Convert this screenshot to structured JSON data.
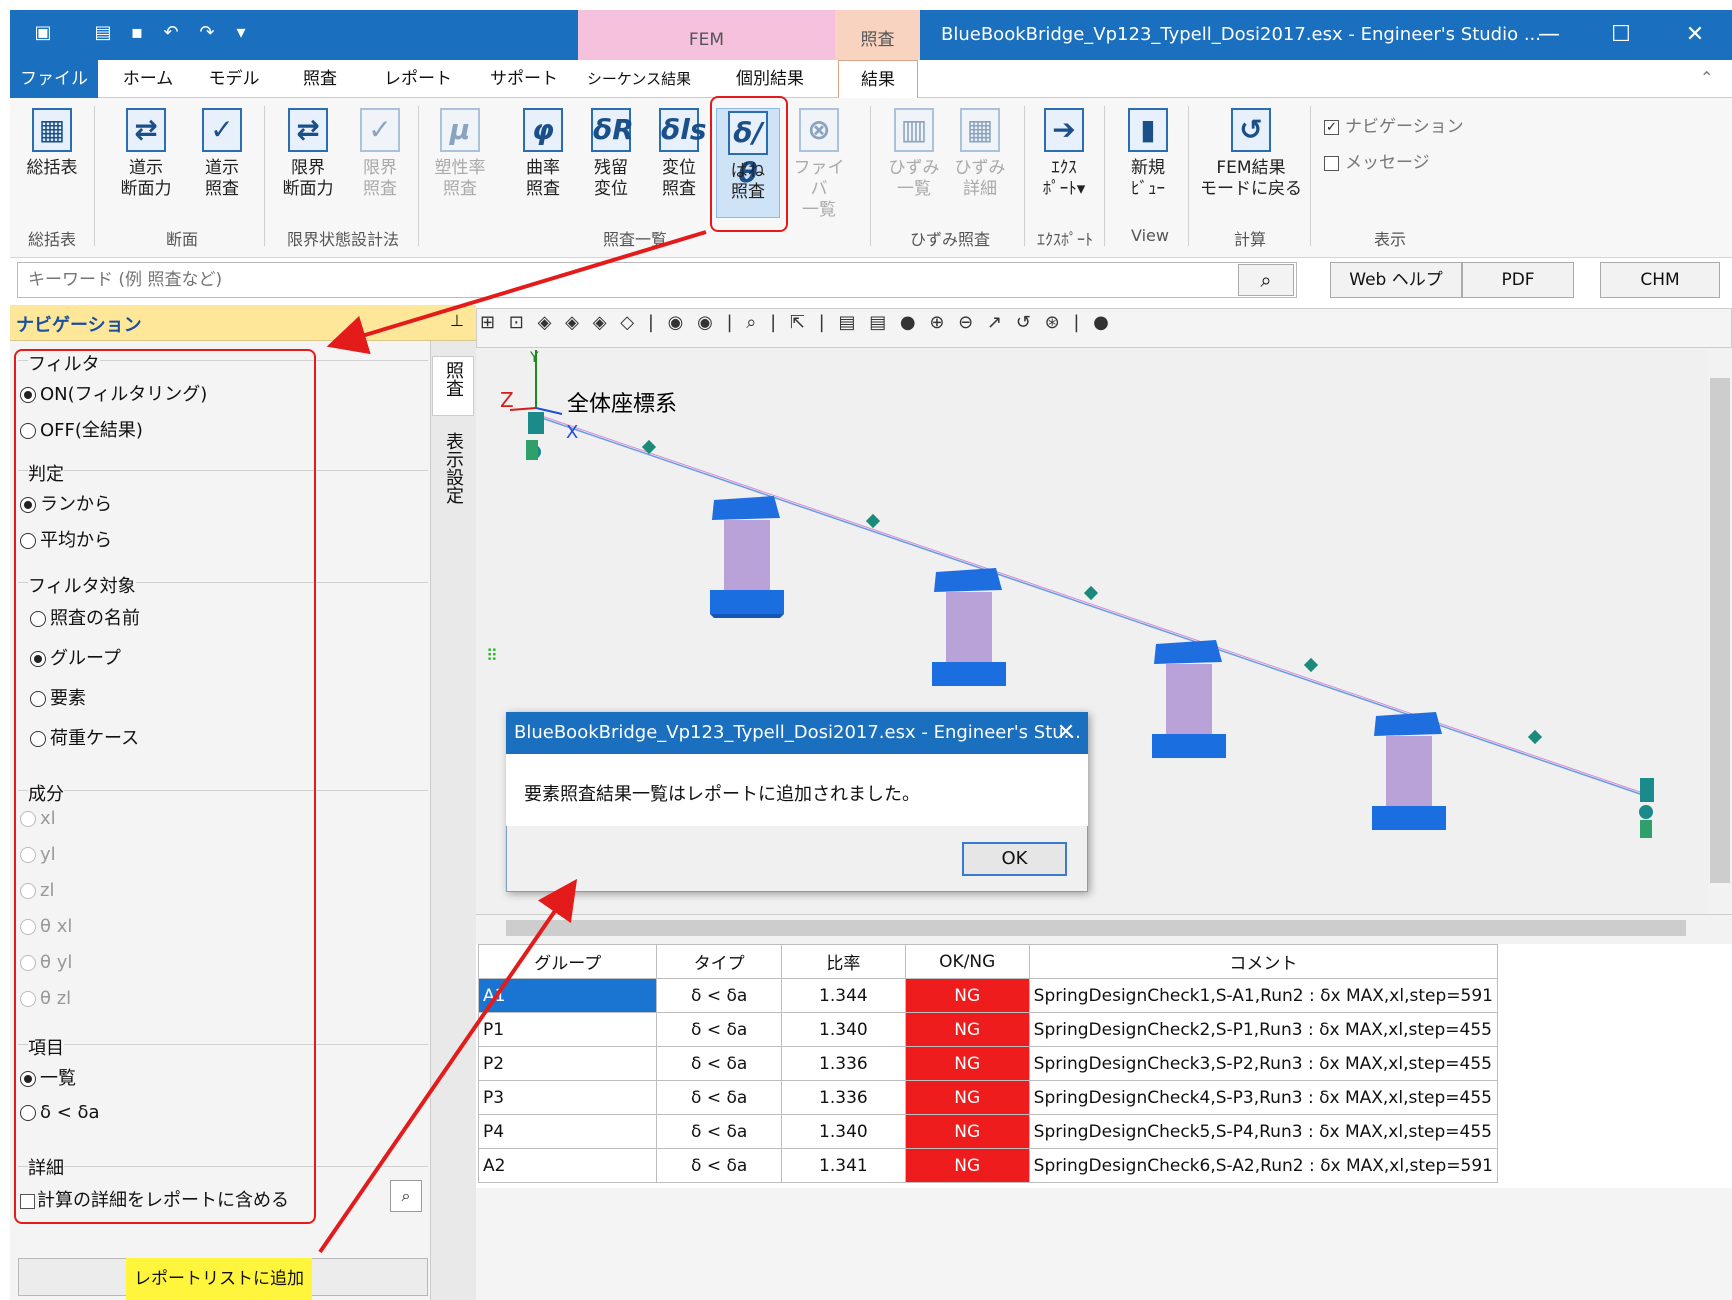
{
  "window": {
    "title": "BlueBookBridge_Vp123_Typell_Dosi2017.esx - Engineer's Studio ...",
    "context_fem": "FEM",
    "context_shosa": "照査",
    "minimize": "—",
    "maximize": "☐",
    "close": "✕"
  },
  "tabs": {
    "file": "ファイル",
    "home": "ホーム",
    "model": "モデル",
    "shosa": "照査",
    "report": "レポート",
    "support": "サポート",
    "sequence": "シーケンス結果",
    "individual": "個別結果",
    "result": "結果"
  },
  "ribbon": {
    "b1": "総括表",
    "b2": [
      "道示",
      "断面力"
    ],
    "b3": [
      "道示",
      "照査"
    ],
    "b4": [
      "限界",
      "断面力"
    ],
    "b5": [
      "限界",
      "照査"
    ],
    "b6": [
      "塑性率",
      "照査"
    ],
    "b7": [
      "曲率",
      "照査"
    ],
    "b8": [
      "残留",
      "変位"
    ],
    "b9": [
      "変位",
      "照査"
    ],
    "b10": [
      "ばね",
      "照査"
    ],
    "b11": [
      "ファイバ",
      "一覧"
    ],
    "b12": [
      "ひずみ",
      "一覧"
    ],
    "b13": [
      "ひずみ",
      "詳細"
    ],
    "b14": [
      "ｴｸｽ",
      "ﾎﾟｰﾄ▾"
    ],
    "b15": [
      "新規",
      "ﾋﾞｭｰ"
    ],
    "b16": [
      "FEM結果",
      "モードに戻る"
    ],
    "show_nav": "ナビゲーション",
    "show_msg": "メッセージ",
    "groups": {
      "g1": "総括表",
      "g2": "断面",
      "g3": "限界状態設計法",
      "g4": "照査一覧",
      "g5": "ひずみ照査",
      "g6": "ｴｸｽﾎﾟｰﾄ",
      "g7": "View",
      "g8": "計算",
      "g9": "表示"
    }
  },
  "search": {
    "placeholder": "キーワード (例 照査など)",
    "web_help": "Web ヘルプ",
    "pdf": "PDF",
    "chm": "CHM"
  },
  "nav": {
    "title": "ナビゲーション",
    "vtab1": "照査",
    "vtab2": "表示設定",
    "filter": {
      "label": "フィルタ",
      "on": "ON(フィルタリング)",
      "off": "OFF(全結果)"
    },
    "judge": {
      "label": "判定",
      "from_run": "ランから",
      "from_avg": "平均から"
    },
    "target": {
      "label": "フィルタ対象",
      "name": "照査の名前",
      "group": "グループ",
      "element": "要素",
      "load": "荷重ケース"
    },
    "component": {
      "label": "成分",
      "items": [
        "xl",
        "yl",
        "zl",
        "θ xl",
        "θ yl",
        "θ zl"
      ]
    },
    "item": {
      "label": "項目",
      "list": "一覧",
      "delta": "δ < δa"
    },
    "detail": {
      "label": "詳細",
      "include": "計算の詳細をレポートに含める"
    },
    "add_button": "レポートリストに追加"
  },
  "view3d": {
    "coord_label": "全体座標系",
    "axis_x": "X",
    "axis_y": "Y",
    "axis_z": "Z",
    "toolbar": "⊞ ⊡ ◈ ◈ ◈ ◇ | ◉ ◉ | ⌕ | ⇱ | ▤ ▤ ● ⊕ ⊖ ↗ ↺ ⊛ | ●"
  },
  "dialog": {
    "title": "BlueBookBridge_Vp123_Typell_Dosi2017.esx - Engineer's Stu...",
    "message": "要素照査結果一覧はレポートに追加されました。",
    "ok": "OK",
    "close": "✕"
  },
  "results": {
    "headers": [
      "グループ",
      "タイプ",
      "比率",
      "OK/NG",
      "コメント"
    ],
    "rows": [
      {
        "group": "A1",
        "type": "δ < δa",
        "ratio": "1.344",
        "judge": "NG",
        "comment": "SpringDesignCheck1,S-A1,Run2 : δx MAX,xl,step=591"
      },
      {
        "group": "P1",
        "type": "δ < δa",
        "ratio": "1.340",
        "judge": "NG",
        "comment": "SpringDesignCheck2,S-P1,Run3 : δx MAX,xl,step=455"
      },
      {
        "group": "P2",
        "type": "δ < δa",
        "ratio": "1.336",
        "judge": "NG",
        "comment": "SpringDesignCheck3,S-P2,Run3 : δx MAX,xl,step=455"
      },
      {
        "group": "P3",
        "type": "δ < δa",
        "ratio": "1.336",
        "judge": "NG",
        "comment": "SpringDesignCheck4,S-P3,Run3 : δx MAX,xl,step=455"
      },
      {
        "group": "P4",
        "type": "δ < δa",
        "ratio": "1.340",
        "judge": "NG",
        "comment": "SpringDesignCheck5,S-P4,Run3 : δx MAX,xl,step=455"
      },
      {
        "group": "A2",
        "type": "δ < δa",
        "ratio": "1.341",
        "judge": "NG",
        "comment": "SpringDesignCheck6,S-A2,Run2 : δx MAX,xl,step=591"
      }
    ]
  },
  "colors": {
    "accent": "#1a6fbf",
    "ng": "#ee1c1c",
    "highlight_box": "#e31b1b",
    "yellow_highlight": "#fff53d",
    "nav_header": "#ffe79a"
  }
}
